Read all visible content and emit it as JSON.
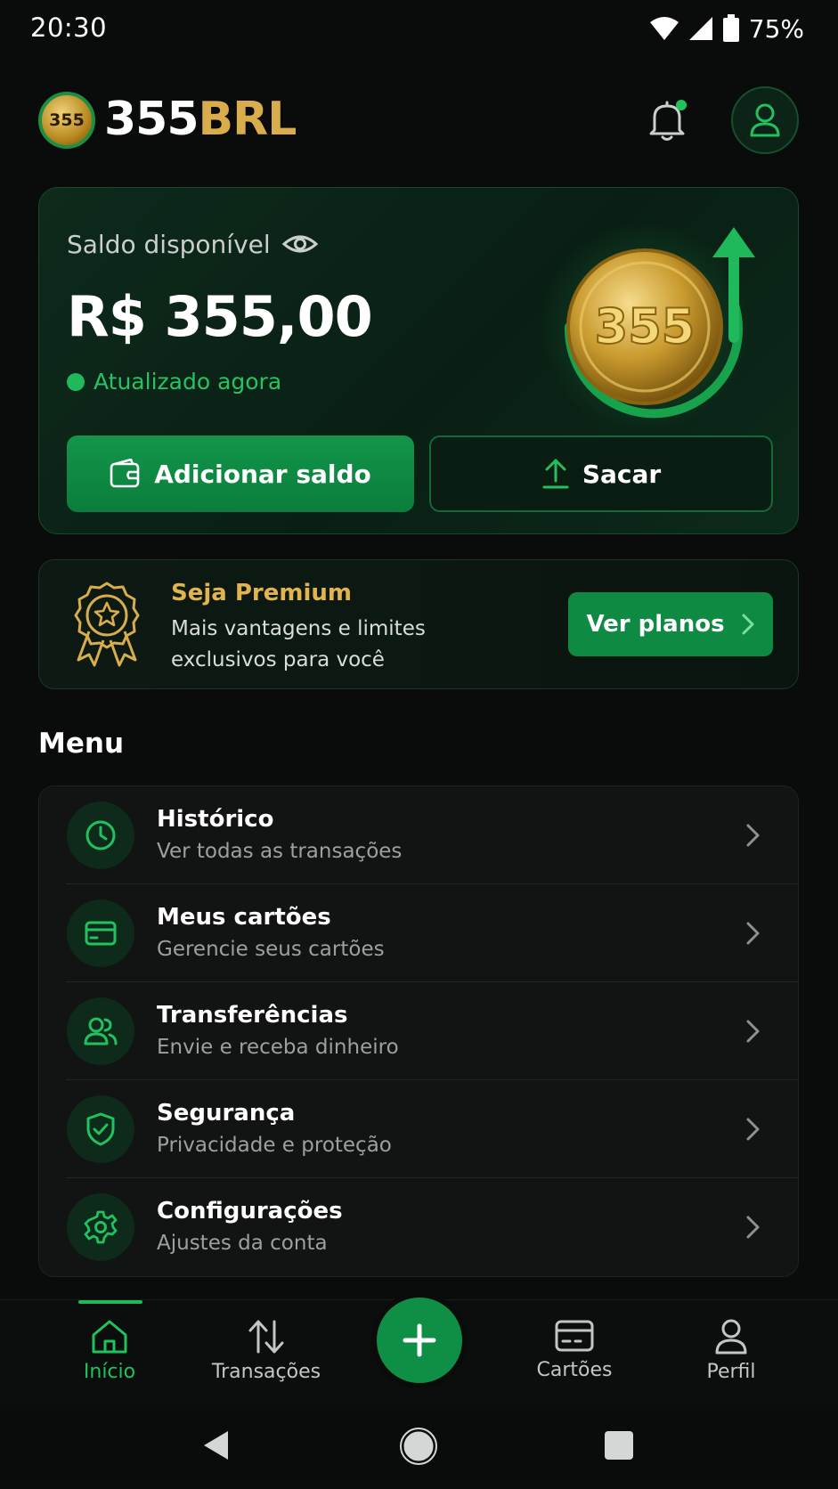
{
  "status_bar": {
    "time": "20:30",
    "battery": "75%"
  },
  "header": {
    "logo_badge": "355",
    "logo_number": "355",
    "logo_currency": "BRL"
  },
  "balance": {
    "label": "Saldo disponível",
    "value": "R$ 355,00",
    "updated": "Atualizado agora",
    "coin_text": "355",
    "add_label": "Adicionar saldo",
    "withdraw_label": "Sacar"
  },
  "premium": {
    "title": "Seja Premium",
    "description": "Mais vantagens e limites exclusivos para você",
    "button_label": "Ver planos"
  },
  "menu": {
    "title": "Menu",
    "items": [
      {
        "label": "Histórico",
        "sub": "Ver todas as transações",
        "icon": "clock-icon"
      },
      {
        "label": "Meus cartões",
        "sub": "Gerencie seus cartões",
        "icon": "credit-card-icon"
      },
      {
        "label": "Transferências",
        "sub": "Envie e receba dinheiro",
        "icon": "users-icon"
      },
      {
        "label": "Segurança",
        "sub": "Privacidade e proteção",
        "icon": "shield-check-icon"
      },
      {
        "label": "Configurações",
        "sub": "Ajustes da conta",
        "icon": "gear-icon"
      }
    ]
  },
  "bottom_nav": {
    "items": [
      {
        "label": "Início",
        "icon": "home-icon",
        "active": true
      },
      {
        "label": "Transações",
        "icon": "arrows-up-down-icon",
        "active": false
      },
      {
        "label": "Cartões",
        "icon": "credit-card-icon",
        "active": false
      },
      {
        "label": "Perfil",
        "icon": "user-icon",
        "active": false
      }
    ]
  },
  "colors": {
    "accent": "#1fb85a",
    "gold": "#d9ad4b",
    "background": "#0a0b0b"
  }
}
